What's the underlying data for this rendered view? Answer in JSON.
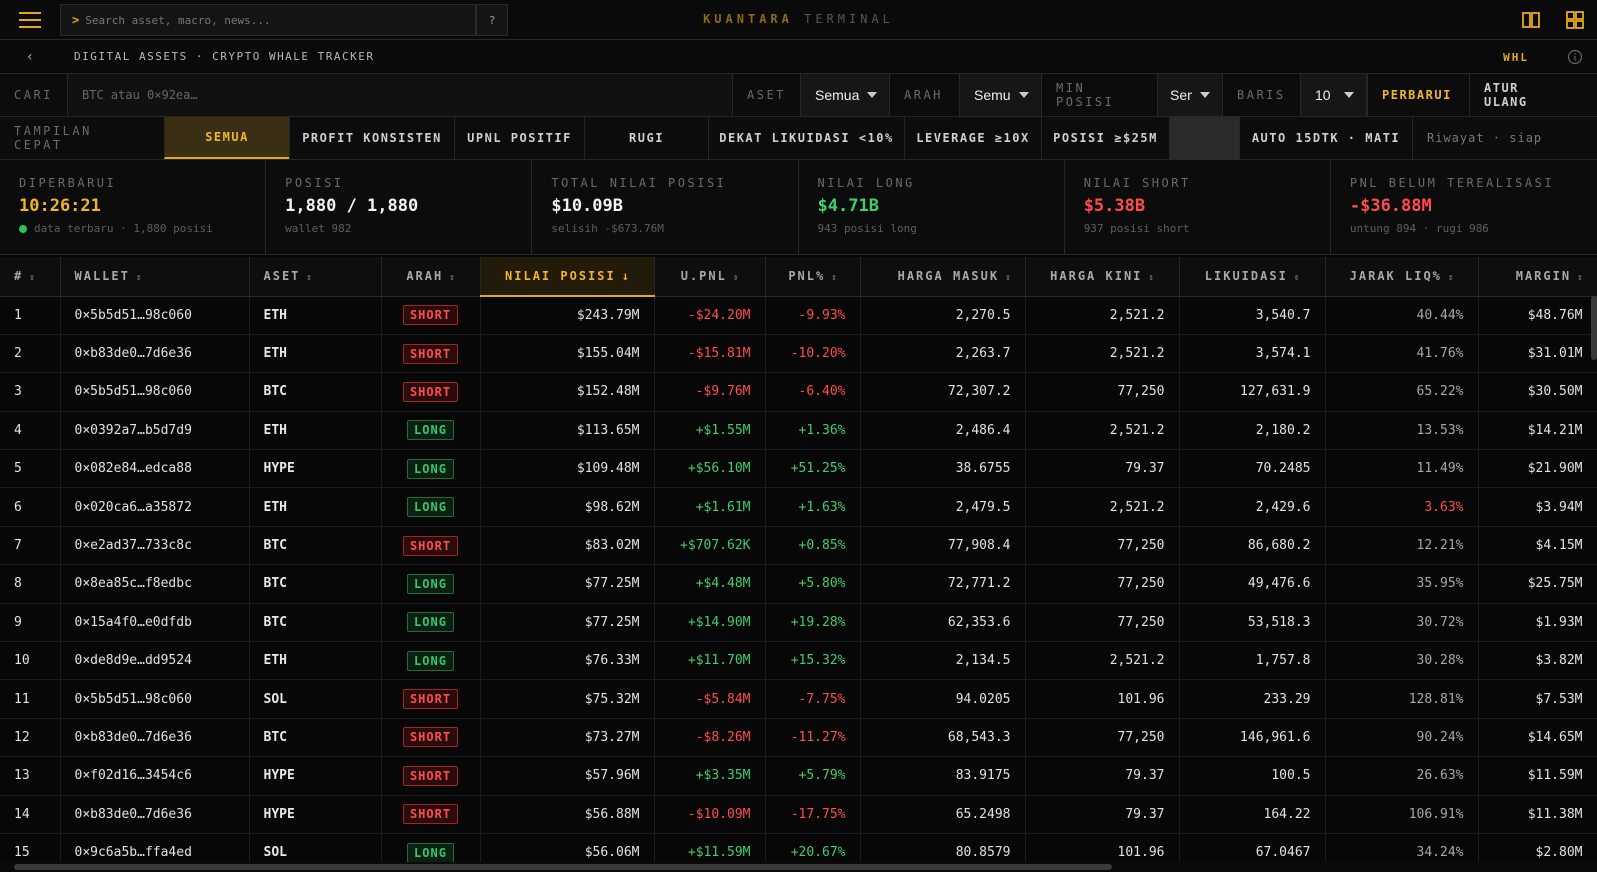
{
  "top": {
    "search_prompt": ">",
    "search_placeholder": "Search asset, macro, news...",
    "help": "?",
    "brand_primary": "KUANTARA",
    "brand_secondary": "TERMINAL"
  },
  "breadcrumb": {
    "back": "‹",
    "path": "DIGITAL ASSETS · CRYPTO WHALE TRACKER",
    "code": "WHL"
  },
  "filters": {
    "search_label": "CARI",
    "search_placeholder": "BTC atau 0×92ea…",
    "asset_label": "ASET",
    "asset_value": "Semua",
    "direction_label": "ARAH",
    "direction_value": "Semua",
    "min_label": "MIN POSISI",
    "min_value": "Semua",
    "rows_label": "BARIS",
    "rows_value": "10",
    "refresh": "PERBARUI",
    "reset": "ATUR ULANG"
  },
  "quick": {
    "label": "TAMPILAN CEPAT",
    "items": [
      "SEMUA",
      "PROFIT KONSISTEN",
      "UPNL POSITIF",
      "RUGI",
      "DEKAT LIKUIDASI <10%",
      "LEVERAGE ≥10X",
      "POSISI ≥$25M"
    ],
    "auto": "AUTO 15DTK · MATI",
    "history": "Riwayat · siap"
  },
  "stats": [
    {
      "label": "DIPERBARUI",
      "value": "10:26:21",
      "sub": "data terbaru · 1,880 posisi"
    },
    {
      "label": "POSISI",
      "value": "1,880 / 1,880",
      "sub": "wallet 982"
    },
    {
      "label": "TOTAL NILAI POSISI",
      "value": "$10.09B",
      "sub": "selisih -$673.76M"
    },
    {
      "label": "NILAI LONG",
      "value": "$4.71B",
      "sub": "943 posisi long"
    },
    {
      "label": "NILAI SHORT",
      "value": "$5.38B",
      "sub": "937 posisi short"
    },
    {
      "label": "PNL BELUM TEREALISASI",
      "value": "-$36.88M",
      "sub": "untung 894 · rugi 986"
    }
  ],
  "colors": {
    "accent": "#e5a81a",
    "positive": "#3fcf6e",
    "negative": "#ff4d4d"
  },
  "table": {
    "columns": [
      "#",
      "WALLET",
      "ASET",
      "ARAH",
      "NILAI POSISI",
      "U.PNL",
      "PNL%",
      "HARGA MASUK",
      "HARGA KINI",
      "LIKUIDASI",
      "JARAK LIQ%",
      "MARGIN"
    ],
    "sort_icon": "⇕",
    "sorted_icon": "↓",
    "rows": [
      [
        "1",
        "0×5b5d51…98c060",
        "ETH",
        "SHORT",
        "$243.79M",
        "-$24.20M",
        "-9.93%",
        "2,270.5",
        "2,521.2",
        "3,540.7",
        "40.44%",
        "$48.76M"
      ],
      [
        "2",
        "0×b83de0…7d6e36",
        "ETH",
        "SHORT",
        "$155.04M",
        "-$15.81M",
        "-10.20%",
        "2,263.7",
        "2,521.2",
        "3,574.1",
        "41.76%",
        "$31.01M"
      ],
      [
        "3",
        "0×5b5d51…98c060",
        "BTC",
        "SHORT",
        "$152.48M",
        "-$9.76M",
        "-6.40%",
        "72,307.2",
        "77,250",
        "127,631.9",
        "65.22%",
        "$30.50M"
      ],
      [
        "4",
        "0×0392a7…b5d7d9",
        "ETH",
        "LONG",
        "$113.65M",
        "+$1.55M",
        "+1.36%",
        "2,486.4",
        "2,521.2",
        "2,180.2",
        "13.53%",
        "$14.21M"
      ],
      [
        "5",
        "0×082e84…edca88",
        "HYPE",
        "LONG",
        "$109.48M",
        "+$56.10M",
        "+51.25%",
        "38.6755",
        "79.37",
        "70.2485",
        "11.49%",
        "$21.90M"
      ],
      [
        "6",
        "0×020ca6…a35872",
        "ETH",
        "LONG",
        "$98.62M",
        "+$1.61M",
        "+1.63%",
        "2,479.5",
        "2,521.2",
        "2,429.6",
        "3.63%",
        "$3.94M"
      ],
      [
        "7",
        "0×e2ad37…733c8c",
        "BTC",
        "SHORT",
        "$83.02M",
        "+$707.62K",
        "+0.85%",
        "77,908.4",
        "77,250",
        "86,680.2",
        "12.21%",
        "$4.15M"
      ],
      [
        "8",
        "0×8ea85c…f8edbc",
        "BTC",
        "LONG",
        "$77.25M",
        "+$4.48M",
        "+5.80%",
        "72,771.2",
        "77,250",
        "49,476.6",
        "35.95%",
        "$25.75M"
      ],
      [
        "9",
        "0×15a4f0…e0dfdb",
        "BTC",
        "LONG",
        "$77.25M",
        "+$14.90M",
        "+19.28%",
        "62,353.6",
        "77,250",
        "53,518.3",
        "30.72%",
        "$1.93M"
      ],
      [
        "10",
        "0×de8d9e…dd9524",
        "ETH",
        "LONG",
        "$76.33M",
        "+$11.70M",
        "+15.32%",
        "2,134.5",
        "2,521.2",
        "1,757.8",
        "30.28%",
        "$3.82M"
      ],
      [
        "11",
        "0×5b5d51…98c060",
        "SOL",
        "SHORT",
        "$75.32M",
        "-$5.84M",
        "-7.75%",
        "94.0205",
        "101.96",
        "233.29",
        "128.81%",
        "$7.53M"
      ],
      [
        "12",
        "0×b83de0…7d6e36",
        "BTC",
        "SHORT",
        "$73.27M",
        "-$8.26M",
        "-11.27%",
        "68,543.3",
        "77,250",
        "146,961.6",
        "90.24%",
        "$14.65M"
      ],
      [
        "13",
        "0×f02d16…3454c6",
        "HYPE",
        "SHORT",
        "$57.96M",
        "+$3.35M",
        "+5.79%",
        "83.9175",
        "79.37",
        "100.5",
        "26.63%",
        "$11.59M"
      ],
      [
        "14",
        "0×b83de0…7d6e36",
        "HYPE",
        "SHORT",
        "$56.88M",
        "-$10.09M",
        "-17.75%",
        "65.2498",
        "79.37",
        "164.22",
        "106.91%",
        "$11.38M"
      ],
      [
        "15",
        "0×9c6a5b…ffa4ed",
        "SOL",
        "LONG",
        "$56.06M",
        "+$11.59M",
        "+20.67%",
        "80.8579",
        "101.96",
        "67.0467",
        "34.24%",
        "$2.80M"
      ]
    ]
  }
}
